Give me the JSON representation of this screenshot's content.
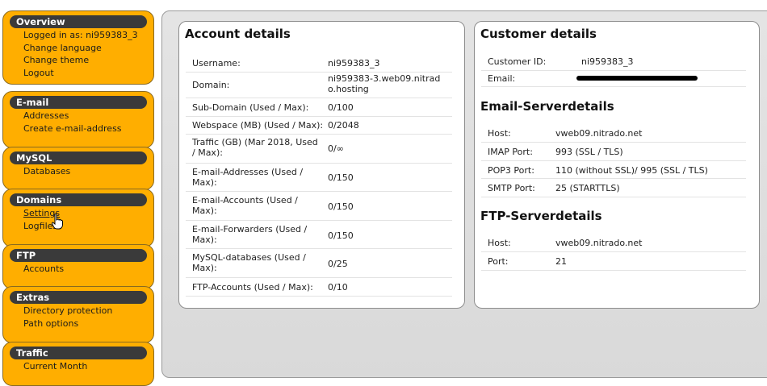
{
  "sidebar": {
    "overview": {
      "title": "Overview",
      "items": [
        "Logged in as: ni959383_3",
        "Change language",
        "Change theme",
        "Logout"
      ]
    },
    "email": {
      "title": "E-mail",
      "items": [
        "Addresses",
        "Create e-mail-address"
      ]
    },
    "mysql": {
      "title": "MySQL",
      "items": [
        "Databases"
      ]
    },
    "domains": {
      "title": "Domains",
      "items": [
        "Settings",
        "Logfiles"
      ]
    },
    "ftp": {
      "title": "FTP",
      "items": [
        "Accounts"
      ]
    },
    "extras": {
      "title": "Extras",
      "items": [
        "Directory protection",
        "Path options"
      ]
    },
    "traffic": {
      "title": "Traffic",
      "items": [
        "Current Month"
      ]
    }
  },
  "account": {
    "title": "Account details",
    "rows": [
      {
        "label": "Username:",
        "value": "ni959383_3"
      },
      {
        "label": "Domain:",
        "value": "ni959383-3.web09.nitrado.hosting"
      },
      {
        "label": "Sub-Domain (Used / Max):",
        "value": "0/100"
      },
      {
        "label": "Webspace (MB) (Used / Max):",
        "value": "0/2048"
      },
      {
        "label": "Traffic (GB) (Mar 2018, Used / Max):",
        "value": "0/∞"
      },
      {
        "label": "E-mail-Addresses (Used / Max):",
        "value": "0/150"
      },
      {
        "label": "E-mail-Accounts (Used / Max):",
        "value": "0/150"
      },
      {
        "label": "E-mail-Forwarders (Used / Max):",
        "value": "0/150"
      },
      {
        "label": "MySQL-databases (Used / Max):",
        "value": "0/25"
      },
      {
        "label": "FTP-Accounts (Used / Max):",
        "value": "0/10"
      }
    ]
  },
  "customer": {
    "title": "Customer details",
    "rows": [
      {
        "label": "Customer ID:",
        "value": "ni959383_3"
      },
      {
        "label": "Email:",
        "value": ""
      }
    ]
  },
  "email_server": {
    "title": "Email-Serverdetails",
    "rows": [
      {
        "label": "Host:",
        "value": "vweb09.nitrado.net"
      },
      {
        "label": "IMAP Port:",
        "value": "993 (SSL / TLS)"
      },
      {
        "label": "POP3 Port:",
        "value": "110 (without SSL)/ 995 (SSL / TLS)"
      },
      {
        "label": "SMTP Port:",
        "value": "25 (STARTTLS)"
      }
    ]
  },
  "ftp_server": {
    "title": "FTP-Serverdetails",
    "rows": [
      {
        "label": "Host:",
        "value": "vweb09.nitrado.net"
      },
      {
        "label": "Port:",
        "value": "21"
      }
    ]
  }
}
